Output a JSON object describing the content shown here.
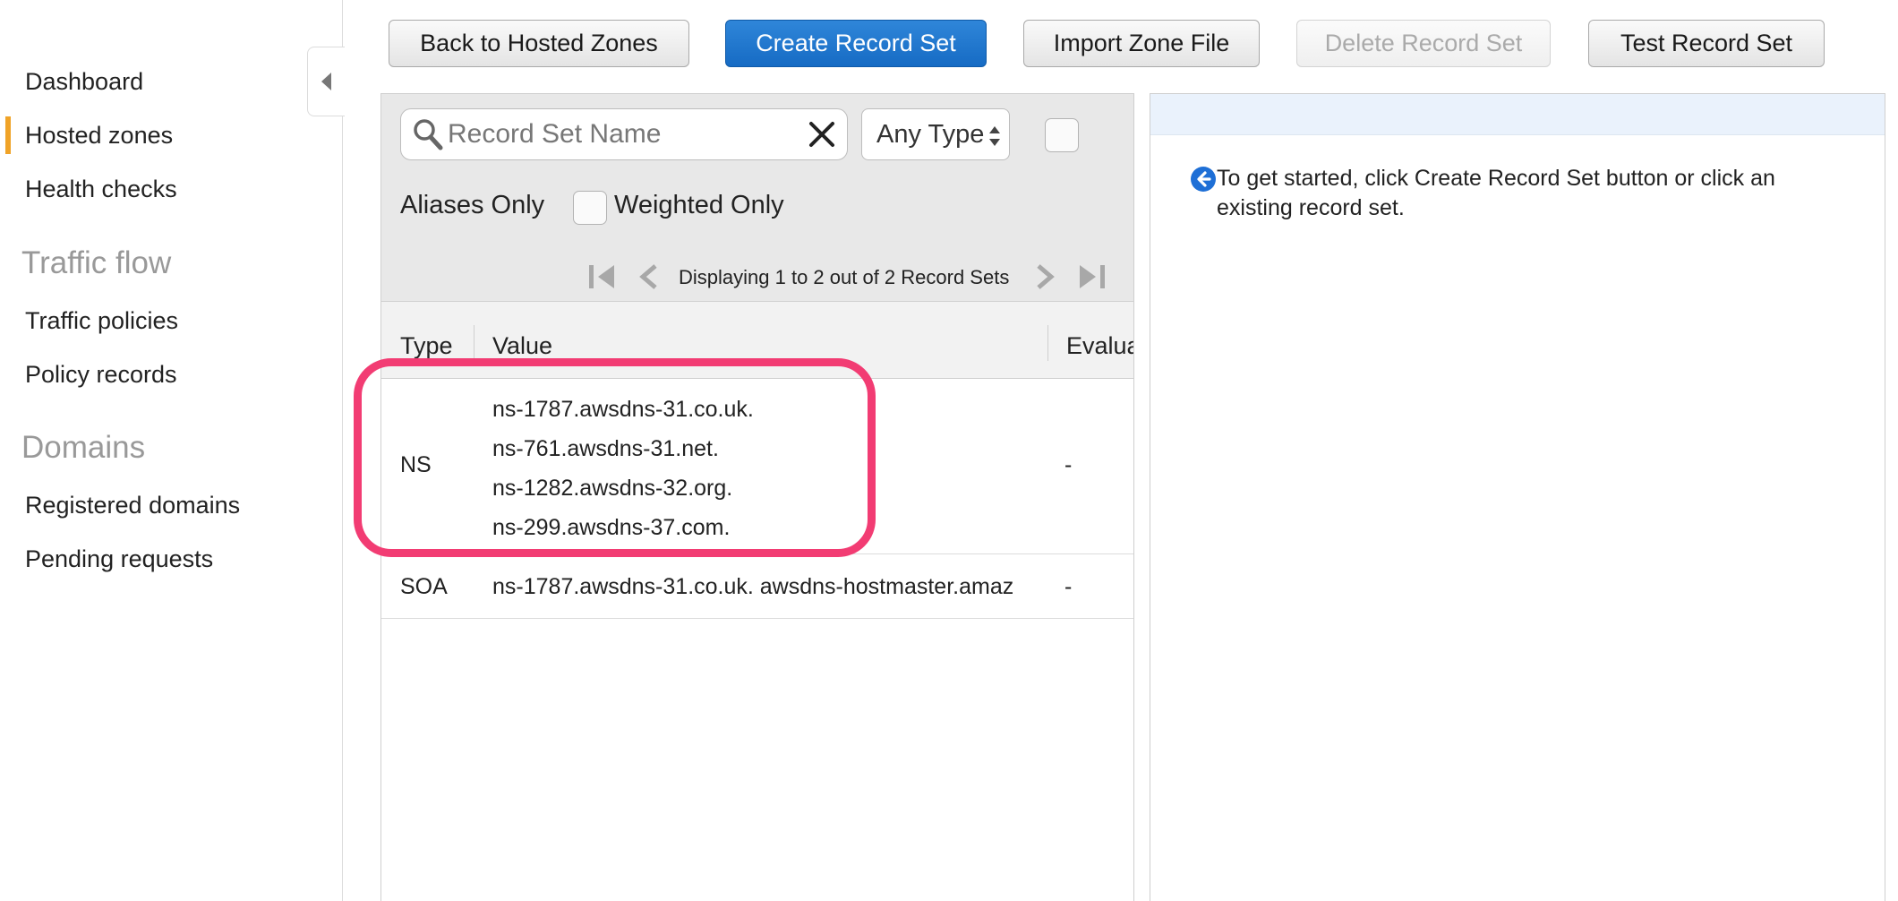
{
  "sidebar": {
    "items": [
      {
        "label": "Dashboard"
      },
      {
        "label": "Hosted zones",
        "active": true
      },
      {
        "label": "Health checks"
      }
    ],
    "sections": [
      {
        "title": "Traffic flow",
        "items": [
          {
            "label": "Traffic policies"
          },
          {
            "label": "Policy records"
          }
        ]
      },
      {
        "title": "Domains",
        "items": [
          {
            "label": "Registered domains"
          },
          {
            "label": "Pending requests"
          }
        ]
      }
    ],
    "accent_color": "#f0a327"
  },
  "toolbar": {
    "back_label": "Back to Hosted Zones",
    "create_label": "Create Record Set",
    "import_label": "Import Zone File",
    "delete_label": "Delete Record Set",
    "delete_disabled": true,
    "test_label": "Test Record Set",
    "primary_color": "#1a73cd"
  },
  "filters": {
    "search_placeholder": "Record Set Name",
    "search_value": "",
    "type_select": "Any Type",
    "aliases_label": "Aliases Only",
    "weighted_label": "Weighted Only"
  },
  "pagination": {
    "text": "Displaying 1 to 2 out of 2 Record Sets"
  },
  "table": {
    "columns": [
      "Type",
      "Value",
      "Evalua"
    ],
    "rows": [
      {
        "type": "NS",
        "values": [
          "ns-1787.awsdns-31.co.uk.",
          "ns-761.awsdns-31.net.",
          "ns-1282.awsdns-32.org.",
          "ns-299.awsdns-37.com."
        ],
        "evaluate": "-"
      },
      {
        "type": "SOA",
        "values": [
          "ns-1787.awsdns-31.co.uk. awsdns-hostmaster.amaz"
        ],
        "evaluate": "-"
      }
    ]
  },
  "detail": {
    "message": "To get started, click Create Record Set button or click an existing record set."
  },
  "highlight_color": "#f23c73"
}
